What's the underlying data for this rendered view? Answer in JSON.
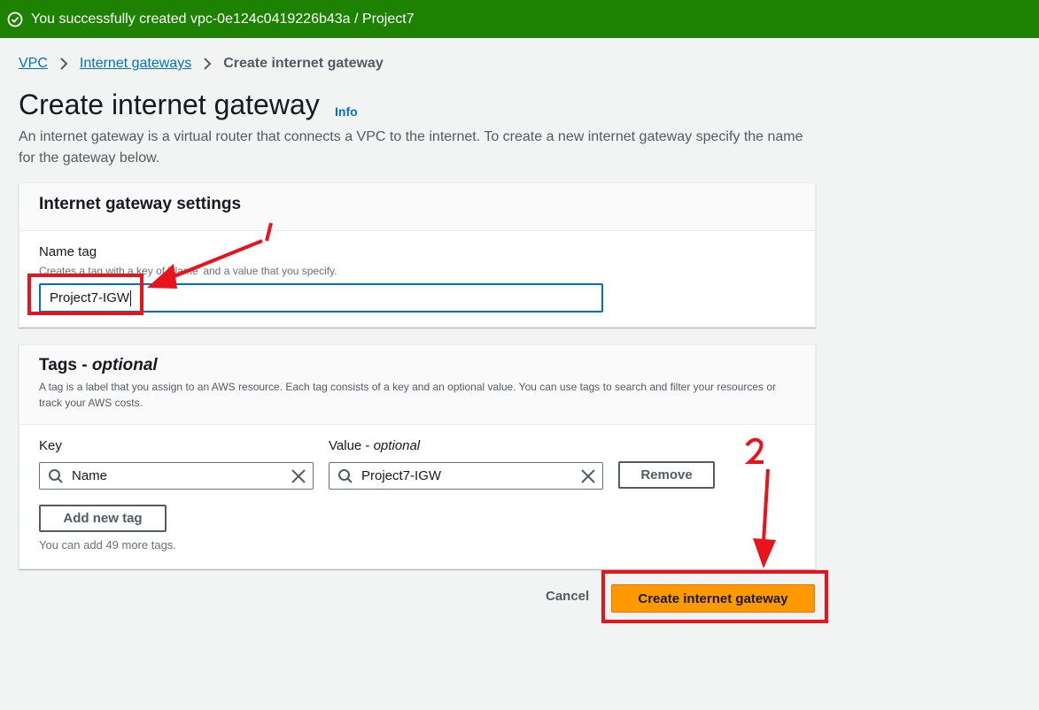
{
  "flash": {
    "message": "You successfully created vpc-0e124c0419226b43a / Project7",
    "color": "#1d8102"
  },
  "breadcrumb": {
    "items": [
      "VPC",
      "Internet gateways"
    ],
    "current": "Create internet gateway"
  },
  "page": {
    "title": "Create internet gateway",
    "info_label": "Info",
    "description": "An internet gateway is a virtual router that connects a VPC to the internet. To create a new internet gateway specify the name for the gateway below."
  },
  "settings_panel": {
    "title": "Internet gateway settings",
    "name_tag_label": "Name tag",
    "name_tag_desc": "Creates a tag with a key of 'Name' and a value that you specify.",
    "name_tag_value": "Project7-IGW"
  },
  "tags_panel": {
    "title": "Tags - ",
    "title_optional": "optional",
    "description": "A tag is a label that you assign to an AWS resource. Each tag consists of a key and an optional value. You can use tags to search and filter your resources or track your AWS costs.",
    "key_label": "Key",
    "value_label": "Value - ",
    "value_optional": "optional",
    "key_value": "Name",
    "value_value": "Project7-IGW",
    "remove_label": "Remove",
    "add_tag_label": "Add new tag",
    "limit_text": "You can add 49 more tags."
  },
  "footer": {
    "cancel_label": "Cancel",
    "create_label": "Create internet gateway",
    "accent": "#ff9900"
  },
  "annotations": {
    "label_1": "1",
    "label_2": "2",
    "color": "#e8141c"
  }
}
